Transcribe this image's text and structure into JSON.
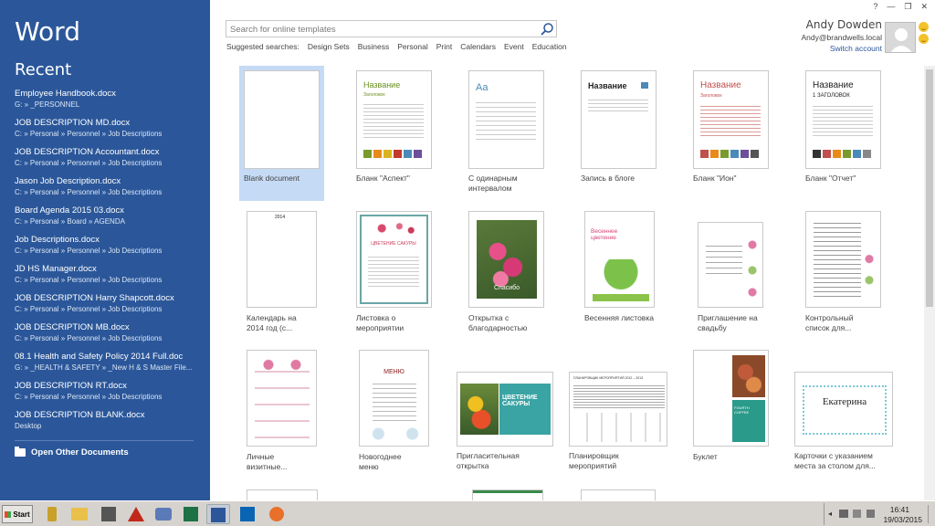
{
  "app": {
    "title": "Word",
    "recent_heading": "Recent"
  },
  "window_controls": {
    "help": "?",
    "minimize": "—",
    "restore": "❐",
    "close": "✕"
  },
  "recent": [
    {
      "name": "Employee Handbook.docx",
      "path": "G: » _PERSONNEL"
    },
    {
      "name": "JOB DESCRIPTION MD.docx",
      "path": "C: » Personal » Personnel » Job Descriptions"
    },
    {
      "name": "JOB DESCRIPTION Accountant.docx",
      "path": "C: » Personal » Personnel » Job Descriptions"
    },
    {
      "name": "Jason Job Description.docx",
      "path": "C: » Personal » Personnel » Job Descriptions"
    },
    {
      "name": "Board Agenda 2015 03.docx",
      "path": "C: » Personal » Board » AGENDA"
    },
    {
      "name": "Job Descriptions.docx",
      "path": "C: » Personal » Personnel » Job Descriptions"
    },
    {
      "name": "JD HS Manager.docx",
      "path": "C: » Personal » Personnel » Job Descriptions"
    },
    {
      "name": "JOB DESCRIPTION Harry Shapcott.docx",
      "path": "C: » Personal » Personnel » Job Descriptions"
    },
    {
      "name": "JOB DESCRIPTION MB.docx",
      "path": "C: » Personal » Personnel » Job Descriptions"
    },
    {
      "name": "08.1 Health and Safety Policy 2014 Full.doc",
      "path": "G: » _HEALTH & SAFETY » _New H & S Master File..."
    },
    {
      "name": "JOB DESCRIPTION RT.docx",
      "path": "C: » Personal » Personnel » Job Descriptions"
    },
    {
      "name": "JOB DESCRIPTION BLANK.docx",
      "path": "Desktop"
    }
  ],
  "open_other": "Open Other Documents",
  "search": {
    "placeholder": "Search for online templates"
  },
  "suggested": {
    "label": "Suggested searches:",
    "items": [
      "Design Sets",
      "Business",
      "Personal",
      "Print",
      "Calendars",
      "Event",
      "Education"
    ]
  },
  "account": {
    "name": "Andy Dowden",
    "email": "Andy@brandwells.local",
    "switch": "Switch account"
  },
  "templates": {
    "t1": {
      "label": "Blank document"
    },
    "t2": {
      "label": "Бланк \"Аспект\"",
      "title": "Название",
      "subtitle": "Заголовок"
    },
    "t3": {
      "label": "С одинарным интервалом",
      "title": "Aa"
    },
    "t4": {
      "label": "Запись в блоге",
      "title": "Название"
    },
    "t5": {
      "label": "Бланк \"Ион\"",
      "title": "Название",
      "subtitle": "Заголовок"
    },
    "t6": {
      "label": "Бланк \"Отчет\"",
      "title": "Название",
      "subtitle": "1 ЗАГОЛОВОК"
    },
    "t7": {
      "label": "Календарь на 2014 год (с...",
      "title": "2014"
    },
    "t8": {
      "label": "Листовка о мероприятии",
      "title": "ЦВЕТЕНИЕ САКУРЫ"
    },
    "t9": {
      "label": "Открытка с благодарностью",
      "title": "Спасибо"
    },
    "t10": {
      "label": "Весенняя листовка",
      "title": "Весеннее цветение"
    },
    "t11": {
      "label": "Приглашение на свадьбу"
    },
    "t12": {
      "label": "Контрольный список для..."
    },
    "t13": {
      "label": "Личные визитные..."
    },
    "t14": {
      "label": "Новогоднее меню",
      "title": "МЕНЮ"
    },
    "t15": {
      "label": "Пригласительная открытка",
      "title": "ЦВЕТЕНИЕ САКУРЫ"
    },
    "t16": {
      "label": "Планировщик мероприятий",
      "title": "ПЛАНИРОВЩИК МЕРОПРИЯТИЙ 2012 – 2013"
    },
    "t17": {
      "label": "Буклет",
      "title": "FOURTH COFFEE"
    },
    "t18": {
      "label": "Карточки с указанием места за столом для...",
      "title": "Екатерина"
    }
  },
  "taskbar": {
    "start": "Start",
    "time": "16:41",
    "date": "19/03/2015"
  },
  "colors": {
    "accent": "#2b579a",
    "selected": "#c5daf5"
  }
}
